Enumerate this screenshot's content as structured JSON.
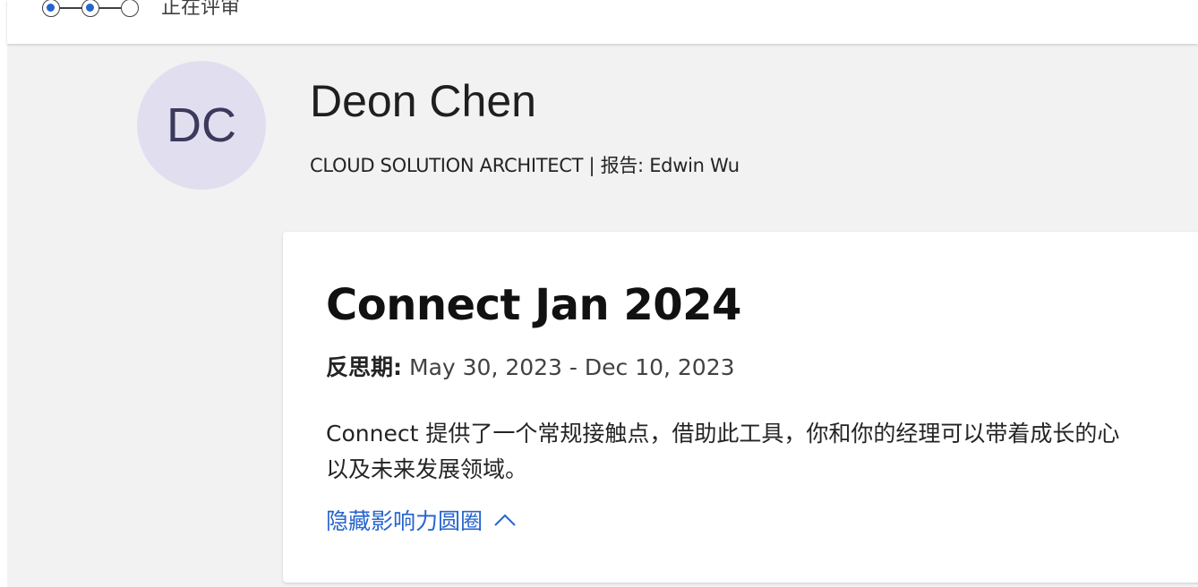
{
  "stepper": {
    "steps": [
      "done",
      "done",
      "pending"
    ],
    "current_label": "正在评审"
  },
  "profile": {
    "initials": "DC",
    "name": "Deon Chen",
    "meta": "CLOUD SOLUTION ARCHITECT | 报告: Edwin Wu"
  },
  "card": {
    "title": "Connect Jan 2024",
    "period_label": "反思期:",
    "period_value": "May 30, 2023 - Dec 10, 2023",
    "description_line1": "Connect 提供了一个常规接触点，借助此工具，你和你的经理可以带着成长的心",
    "description_line2": "以及未来发展领域。",
    "hide_link": "隐藏影响力圆圈"
  },
  "colors": {
    "accent": "#2564cf",
    "avatar_bg": "#e1dfef",
    "page_bg": "#f2f2f2"
  }
}
